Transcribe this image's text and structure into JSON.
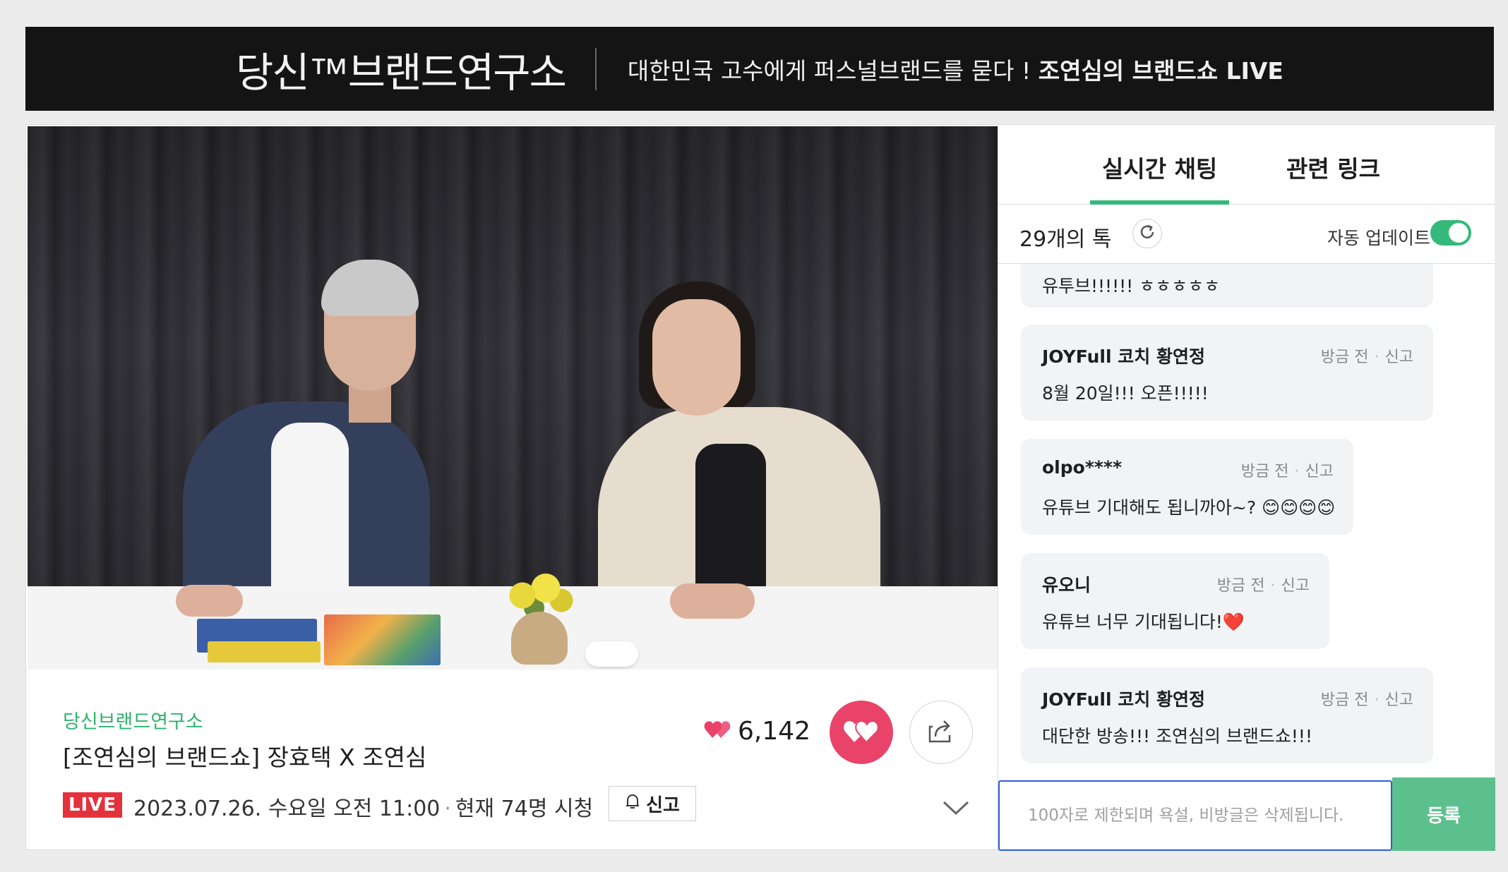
{
  "banner": {
    "logo_text": "당신™브랜드연구소",
    "tagline_regular": "대한민국 고수에게 퍼스널브랜드를 묻다 ! ",
    "tagline_bold": "조연심의 브랜드쇼 LIVE"
  },
  "broadcast": {
    "channel": "당신브랜드연구소",
    "title": "[조연심의 브랜드쇼] 장효택 X 조연심",
    "live_badge": "LIVE",
    "datetime": "2023.07.26. 수요일 오전 11:00",
    "viewers": "현재 74명 시청",
    "report_label": "신고",
    "like_count": "6,142"
  },
  "chat": {
    "tabs": [
      {
        "label": "실시간 채팅",
        "active": true
      },
      {
        "label": "관련 링크",
        "active": false
      }
    ],
    "count_label": "29개의 톡",
    "auto_update_label": "자동 업데이트",
    "auto_update_on": true,
    "messages": [
      {
        "author": "",
        "time": "",
        "report": "",
        "text": "유투브!!!!!! ㅎㅎㅎㅎㅎ"
      },
      {
        "author": "JOYFull 코치 황연정",
        "time": "방금 전",
        "report": "신고",
        "text": "8월 20일!!! 오픈!!!!!"
      },
      {
        "author": "olpo****",
        "time": "방금 전",
        "report": "신고",
        "text": "유튜브 기대해도 됩니까아~? 😊😊😊😊"
      },
      {
        "author": "유오니",
        "time": "방금 전",
        "report": "신고",
        "text": "유튜브 너무 기대됩니다!❤️"
      },
      {
        "author": "JOYFull 코치 황연정",
        "time": "방금 전",
        "report": "신고",
        "text": "대단한 방송!!! 조연심의 브랜드쇼!!!"
      }
    ],
    "input_placeholder": "100자로 제한되며 욕설, 비방글은 삭제됩니다.",
    "submit_label": "등록"
  },
  "colors": {
    "accent_green": "#35b97a",
    "live_red": "#e2333d",
    "like_pink": "#e9436a",
    "input_border": "#2f5bd7"
  },
  "icons": [
    "heart-icon",
    "share-icon",
    "bell-icon",
    "refresh-icon",
    "chevron-down-icon"
  ]
}
